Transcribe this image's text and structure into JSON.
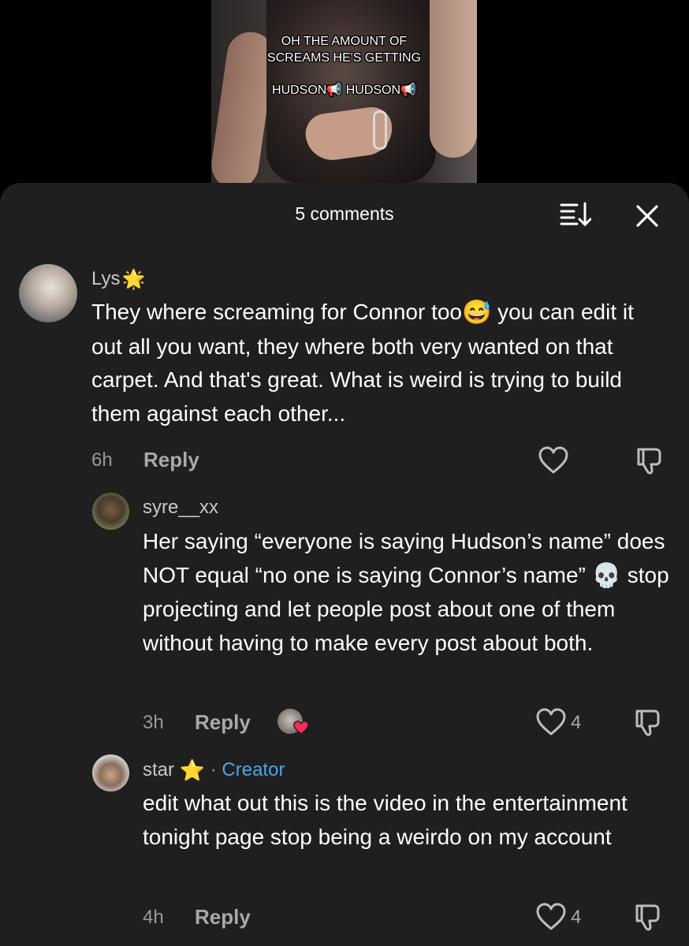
{
  "video": {
    "caption_line1": "OH THE AMOUNT OF",
    "caption_line2": "SCREAMS HE'S GETTING",
    "caption_line3": "HUDSON📢 HUDSON📢"
  },
  "sheet": {
    "title": "5 comments",
    "sort_icon": "sort-icon",
    "close_icon": "close-icon"
  },
  "comments": [
    {
      "username": "Lys",
      "badge_emoji": "🌟",
      "text_before_emoji": "They where screaming for Connor too",
      "inline_emoji": "😅",
      "text_after_emoji": " you can edit it out all you want, they where both very wanted on that carpet. And that's great. What is weird is trying to build them against each other...",
      "time": "6h",
      "reply_label": "Reply",
      "like_count": ""
    },
    {
      "username": "syre__xx",
      "text_before_emoji": "Her saying “everyone is saying Hudson’s name” does NOT equal “no one is saying Connor’s name” ",
      "inline_emoji": "💀",
      "text_after_emoji": " stop projecting and let people post about one of them without having to make every post about both.",
      "time": "3h",
      "reply_label": "Reply",
      "like_count": "4"
    },
    {
      "username": "star",
      "badge_emoji": "⭐",
      "separator": "·",
      "creator_label": "Creator",
      "text": "edit what out this is the video in the entertainment tonight page stop being a weirdo on my account",
      "time": "4h",
      "reply_label": "Reply",
      "like_count": "4"
    }
  ],
  "colors": {
    "sheet_bg": "#1f1f1f",
    "creator": "#4aa6e8",
    "liked_heart": "#fe2c55"
  }
}
